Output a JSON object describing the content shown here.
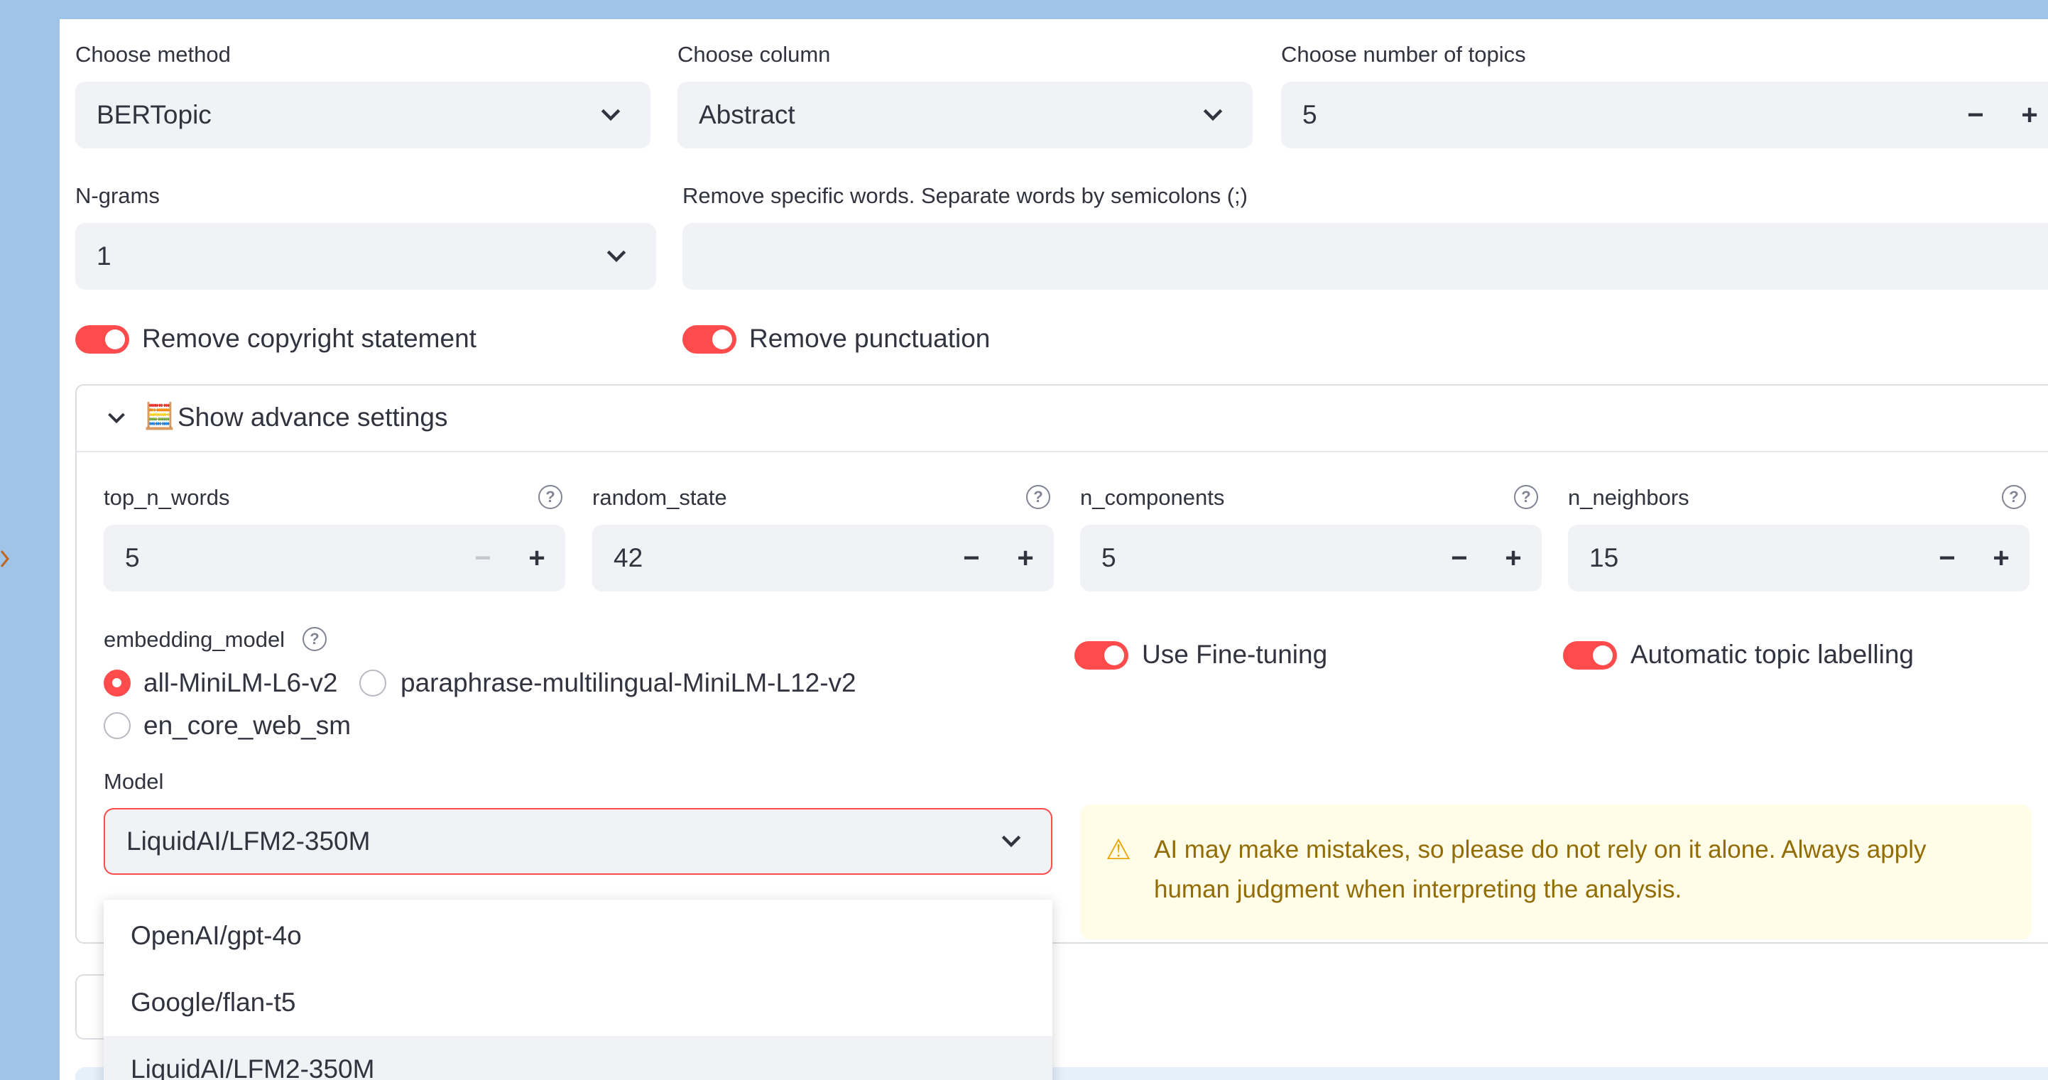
{
  "method": {
    "label": "Choose method",
    "value": "BERTopic"
  },
  "column": {
    "label": "Choose column",
    "value": "Abstract"
  },
  "num_topics": {
    "label": "Choose number of topics",
    "value": "5",
    "minus": "−",
    "plus": "+"
  },
  "ngrams": {
    "label": "N-grams",
    "value": "1"
  },
  "remove_words": {
    "label": "Remove specific words. Separate words by semicolons (;)",
    "value": ""
  },
  "toggles": {
    "copyright": "Remove copyright statement",
    "punctuation": "Remove punctuation"
  },
  "advanced": {
    "title": "Show advance settings",
    "icon": "🧮",
    "help_glyph": "?",
    "steppers": [
      {
        "label": "top_n_words",
        "value": "5",
        "minus": "−",
        "plus": "+",
        "minus_disabled": true
      },
      {
        "label": "random_state",
        "value": "42",
        "minus": "−",
        "plus": "+",
        "minus_disabled": false
      },
      {
        "label": "n_components",
        "value": "5",
        "minus": "−",
        "plus": "+",
        "minus_disabled": false
      },
      {
        "label": "n_neighbors",
        "value": "15",
        "minus": "−",
        "plus": "+",
        "minus_disabled": false
      }
    ],
    "embedding_model": {
      "label": "embedding_model",
      "options": [
        "all-MiniLM-L6-v2",
        "paraphrase-multilingual-MiniLM-L12-v2",
        "en_core_web_sm"
      ],
      "selected": "all-MiniLM-L6-v2"
    },
    "fine_tuning": "Use Fine-tuning",
    "auto_label": "Automatic topic labelling",
    "model": {
      "label": "Model",
      "value": "LiquidAI/LFM2-350M",
      "options": [
        "OpenAI/gpt-4o",
        "Google/flan-t5",
        "LiquidAI/LFM2-350M"
      ]
    },
    "warning": {
      "icon": "⚠",
      "line1": "AI may make mistakes, so please do not rely on it alone. Always apply",
      "line2": "human judgment when interpreting the analysis."
    }
  },
  "colors": {
    "accent": "#ff4b4b",
    "input_bg": "#f0f2f6",
    "background": "#9fc4e7",
    "warning_bg": "#fffce7",
    "warning_text": "#926c05"
  }
}
